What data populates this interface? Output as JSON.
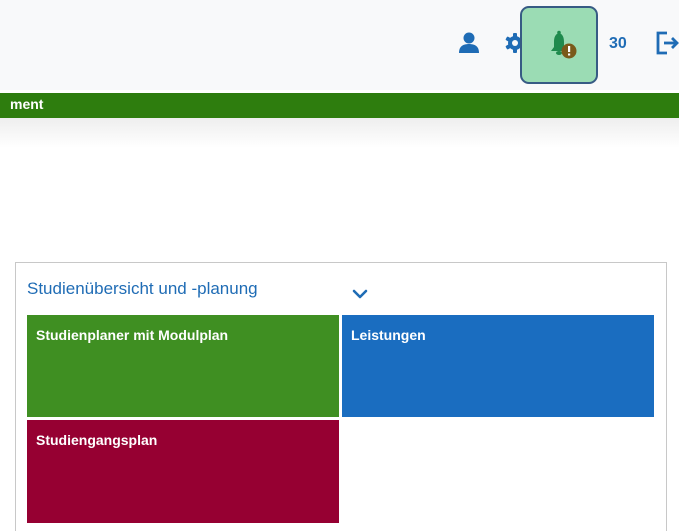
{
  "header": {
    "session_timer": "30",
    "icons": [
      "user-icon",
      "gear-icon",
      "bell-icon",
      "logout-icon"
    ]
  },
  "ribbon": {
    "text": "ment"
  },
  "panel": {
    "title": "Studienübersicht und -planung",
    "tiles": [
      {
        "label": "Studienplaner mit Modulplan",
        "color": "#3f8f22"
      },
      {
        "label": "Leistungen",
        "color": "#1a6dc0"
      },
      {
        "label": "Studiengangsplan",
        "color": "#960032"
      }
    ]
  },
  "colors": {
    "accent_blue": "#1f6cb5",
    "ribbon_green": "#2e7d0e",
    "notification_highlight": "#9bdcb4",
    "notification_border": "#375b84"
  }
}
